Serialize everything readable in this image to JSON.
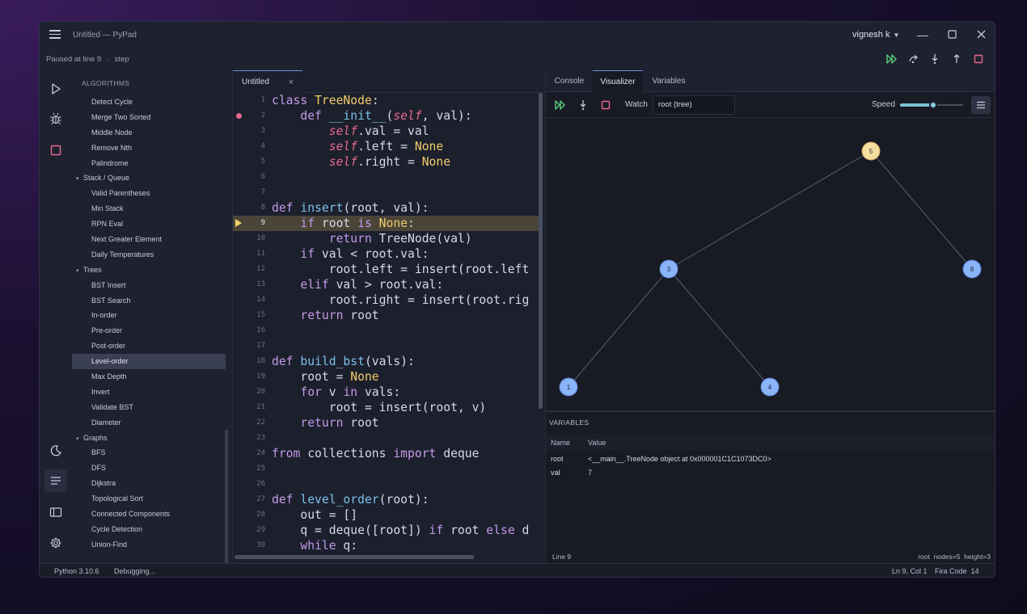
{
  "window": {
    "title": "Untitled — PyPad",
    "user": "vignesh k",
    "status_line": "Paused at line 9",
    "status_sep": "·",
    "status_step": "step"
  },
  "sidebar": {
    "heading": "ALGORITHMS",
    "tree": [
      {
        "type": "item",
        "label": "Detect Cycle"
      },
      {
        "type": "item",
        "label": "Merge Two Sorted"
      },
      {
        "type": "item",
        "label": "Middle Node"
      },
      {
        "type": "item",
        "label": "Remove Nth"
      },
      {
        "type": "item",
        "label": "Palindrome"
      },
      {
        "type": "group",
        "label": "Stack / Queue"
      },
      {
        "type": "item",
        "label": "Valid Parentheses"
      },
      {
        "type": "item",
        "label": "Min Stack"
      },
      {
        "type": "item",
        "label": "RPN Eval"
      },
      {
        "type": "item",
        "label": "Next Greater Element"
      },
      {
        "type": "item",
        "label": "Daily Temperatures"
      },
      {
        "type": "group",
        "label": "Trees"
      },
      {
        "type": "item",
        "label": "BST Insert"
      },
      {
        "type": "item",
        "label": "BST Search"
      },
      {
        "type": "item",
        "label": "In-order"
      },
      {
        "type": "item",
        "label": "Pre-order"
      },
      {
        "type": "item",
        "label": "Post-order"
      },
      {
        "type": "item",
        "label": "Level-order",
        "selected": true
      },
      {
        "type": "item",
        "label": "Max Depth"
      },
      {
        "type": "item",
        "label": "Invert"
      },
      {
        "type": "item",
        "label": "Validate BST"
      },
      {
        "type": "item",
        "label": "Diameter"
      },
      {
        "type": "group",
        "label": "Graphs"
      },
      {
        "type": "item",
        "label": "BFS"
      },
      {
        "type": "item",
        "label": "DFS"
      },
      {
        "type": "item",
        "label": "Dijkstra"
      },
      {
        "type": "item",
        "label": "Topological Sort"
      },
      {
        "type": "item",
        "label": "Connected Components"
      },
      {
        "type": "item",
        "label": "Cycle Detection"
      },
      {
        "type": "item",
        "label": "Union-Find"
      }
    ]
  },
  "editor": {
    "tab_label": "Untitled",
    "tab_close": "×",
    "current_line": 9,
    "breakpoint_line": 2,
    "lines": [
      {
        "n": "1",
        "html": "<span class='k'>class</span> <span class='c'>TreeNode</span>:"
      },
      {
        "n": "2",
        "html": "    <span class='k'>def</span> <span class='f'>__init__</span>(<span class='s'>self</span>, val):"
      },
      {
        "n": "3",
        "html": "        <span class='s'>self</span>.val = val"
      },
      {
        "n": "4",
        "html": "        <span class='s'>self</span>.left = <span class='c'>None</span>"
      },
      {
        "n": "5",
        "html": "        <span class='s'>self</span>.right = <span class='c'>None</span>"
      },
      {
        "n": "6",
        "html": ""
      },
      {
        "n": "7",
        "html": ""
      },
      {
        "n": "8",
        "html": "<span class='k'>def</span> <span class='f'>insert</span>(root, val):"
      },
      {
        "n": "9",
        "html": "    <span class='k'>if</span> root <span class='k'>is</span> <span class='c'>None</span>:"
      },
      {
        "n": "10",
        "html": "        <span class='k'>return</span> TreeNode(val)"
      },
      {
        "n": "11",
        "html": "    <span class='k'>if</span> val &lt; root.val:"
      },
      {
        "n": "12",
        "html": "        root.left = insert(root.left"
      },
      {
        "n": "13",
        "html": "    <span class='k'>elif</span> val &gt; root.val:"
      },
      {
        "n": "14",
        "html": "        root.right = insert(root.rig"
      },
      {
        "n": "15",
        "html": "    <span class='k'>return</span> root"
      },
      {
        "n": "16",
        "html": ""
      },
      {
        "n": "17",
        "html": ""
      },
      {
        "n": "18",
        "html": "<span class='k'>def</span> <span class='f'>build_bst</span>(vals):"
      },
      {
        "n": "19",
        "html": "    root = <span class='c'>None</span>"
      },
      {
        "n": "20",
        "html": "    <span class='k'>for</span> v <span class='k'>in</span> vals:"
      },
      {
        "n": "21",
        "html": "        root = insert(root, v)"
      },
      {
        "n": "22",
        "html": "    <span class='k'>return</span> root"
      },
      {
        "n": "23",
        "html": ""
      },
      {
        "n": "24",
        "html": "<span class='k'>from</span> collections <span class='k'>import</span> deque"
      },
      {
        "n": "25",
        "html": ""
      },
      {
        "n": "26",
        "html": ""
      },
      {
        "n": "27",
        "html": "<span class='k'>def</span> <span class='f'>level_order</span>(root):"
      },
      {
        "n": "28",
        "html": "    out = []"
      },
      {
        "n": "29",
        "html": "    q = deque([root]) <span class='k'>if</span> root <span class='k'>else</span> d"
      },
      {
        "n": "30",
        "html": "    <span class='k'>while</span> q:"
      }
    ]
  },
  "right_panel": {
    "tabs": [
      {
        "label": "Console",
        "active": false
      },
      {
        "label": "Visualizer",
        "active": true
      },
      {
        "label": "Variables",
        "active": false
      }
    ],
    "watch_label": "Watch",
    "watch_value": "root  (tree)",
    "speed_label": "Speed",
    "speed_level": 0.53,
    "tree": {
      "nodes": [
        {
          "id": "5",
          "label": "5",
          "highlight": true
        },
        {
          "id": "3",
          "label": "3"
        },
        {
          "id": "8",
          "label": "8"
        },
        {
          "id": "1",
          "label": "1"
        },
        {
          "id": "4",
          "label": "4"
        }
      ],
      "edges": [
        [
          "5",
          "3"
        ],
        [
          "5",
          "8"
        ],
        [
          "3",
          "1"
        ],
        [
          "3",
          "4"
        ]
      ]
    },
    "variables": {
      "heading": "VARIABLES",
      "col_name": "Name",
      "col_value": "Value",
      "rows": [
        {
          "name": "root",
          "value": "<__main__.TreeNode object at 0x000001C1C1073DC0>"
        },
        {
          "name": "val",
          "value": "7"
        }
      ]
    },
    "status_left": "Line 9",
    "status_right": "root  nodes=5  height=3"
  },
  "statusbar": {
    "python": "Python 3.10.6",
    "state": "Debugging...",
    "position": "Ln 9, Col 1",
    "font": "Fira Code  14"
  },
  "colors": {
    "accent": "#6c8fd8",
    "node": "#8ab4f8",
    "node_highlight": "#f5dfa0",
    "run_green": "#5ad07a",
    "stop_red": "#e86a8e",
    "current_line": "#4a4538"
  },
  "icons": {
    "run": "play-icon",
    "debug": "bug-icon",
    "stop": "stop-icon",
    "theme": "moon-icon",
    "outline": "list-icon",
    "panel": "panel-icon",
    "settings": "gear-icon"
  }
}
